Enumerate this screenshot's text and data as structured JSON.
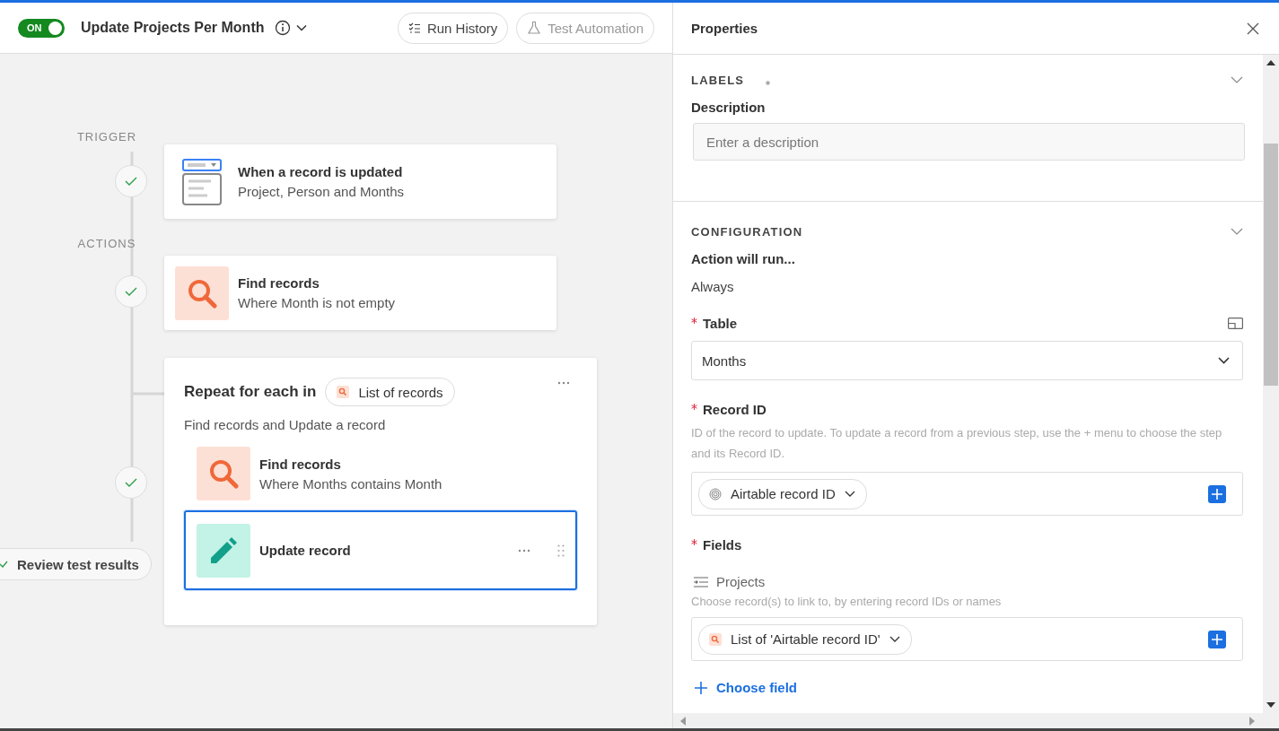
{
  "toolbar": {
    "toggle": {
      "label": "ON",
      "on": true
    },
    "title": "Update Projects Per Month",
    "buttons": [
      {
        "label": "Run History",
        "kind": "history",
        "disabled": false
      },
      {
        "label": "Test Automation",
        "kind": "test",
        "disabled": true
      }
    ]
  },
  "canvas": {
    "trigger_label": "TRIGGER",
    "actions_label": "ACTIONS",
    "trigger": {
      "kind": "form",
      "title": "When a record is updated",
      "subtitle": "Project, Person and Months",
      "passed": true
    },
    "action": {
      "kind": "search",
      "title": "Find records",
      "subtitle": "Where Month is not empty",
      "passed": true
    },
    "repeat": {
      "title": "Repeat for each in",
      "token": "List of records",
      "description": "Find records and Update a record",
      "passed": true,
      "steps": [
        {
          "kind": "search",
          "title": "Find records",
          "subtitle": "Where Months contains Month",
          "selected": false
        },
        {
          "kind": "edit",
          "title": "Update record",
          "selected": true
        }
      ]
    },
    "review_button": "Review test results"
  },
  "properties": {
    "title": "Properties",
    "labels": {
      "heading": "LABELS",
      "field_label": "Description",
      "placeholder": "Enter a description"
    },
    "configuration": {
      "heading": "CONFIGURATION",
      "run_label": "Action will run...",
      "run_value": "Always",
      "table": {
        "label": "Table",
        "required": true,
        "value": "Months"
      },
      "record_id": {
        "label": "Record ID",
        "required": true,
        "help": "ID of the record to update. To update a record from a previous step, use the + menu to choose the step and its Record ID.",
        "token": "Airtable record ID"
      },
      "fields": {
        "label": "Fields",
        "required": true,
        "items": [
          {
            "name": "Projects",
            "help": "Choose record(s) to link to, by entering record IDs or names",
            "token": "List of 'Airtable record ID'"
          }
        ]
      },
      "choose_field": "Choose field"
    }
  }
}
